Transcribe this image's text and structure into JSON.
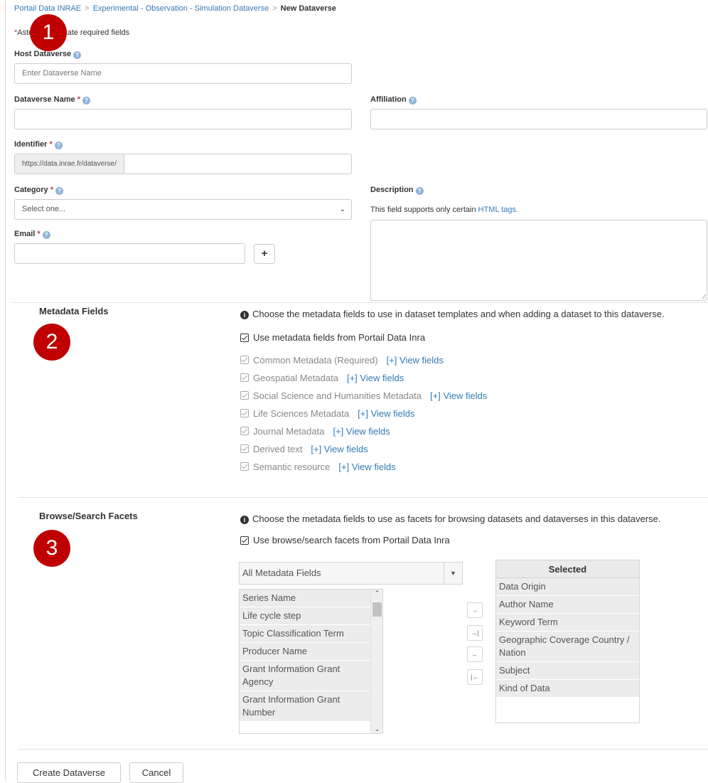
{
  "breadcrumb": {
    "items": [
      "Portail Data INRAE",
      "Experimental - Observation - Simulation Dataverse"
    ],
    "current": "New Dataverse",
    "separator": ">"
  },
  "required_note": {
    "asterisk": "*",
    "text": "Asterisks indicate required fields"
  },
  "form": {
    "host": {
      "label": "Host Dataverse",
      "placeholder": "Enter Dataverse Name"
    },
    "name": {
      "label": "Dataverse Name",
      "value": ""
    },
    "affiliation": {
      "label": "Affiliation",
      "value": ""
    },
    "identifier": {
      "label": "Identifier",
      "prefix": "https://data.inrae.fr/dataverse/",
      "value": ""
    },
    "category": {
      "label": "Category",
      "selected": "Select one..."
    },
    "description": {
      "label": "Description",
      "note": "This field supports only certain",
      "note_link": "HTML tags."
    },
    "email": {
      "label": "Email",
      "value": "",
      "add_label": "+"
    },
    "required_mark": "*",
    "help_glyph": "?"
  },
  "badges": [
    "1",
    "2",
    "3"
  ],
  "metadata_fields": {
    "title": "Metadata Fields",
    "info": "Choose the metadata fields to use in dataset templates and when adding a dataset to this dataverse.",
    "use_label": "Use metadata fields from Portail Data Inra",
    "blocks": [
      {
        "name": "Common Metadata (Required)",
        "link": "[+] View fields"
      },
      {
        "name": "Geospatial Metadata",
        "link": "[+] View fields"
      },
      {
        "name": "Social Science and Humanities Metadata",
        "link": "[+] View fields"
      },
      {
        "name": "Life Sciences Metadata",
        "link": "[+] View fields"
      },
      {
        "name": "Journal Metadata",
        "link": "[+] View fields"
      },
      {
        "name": "Derived text",
        "link": "[+] View fields"
      },
      {
        "name": "Semantic resource",
        "link": "[+] View fields"
      }
    ]
  },
  "facets": {
    "title": "Browse/Search Facets",
    "info": "Choose the metadata fields to use as facets for browsing datasets and dataverses in this dataverse.",
    "use_label": "Use browse/search facets from Portail Data Inra",
    "field_select": "All Metadata Fields",
    "source": [
      "Series Name",
      "Life cycle step",
      "Topic Classification Term",
      "Producer Name",
      "Grant Information Grant Agency",
      "Grant Information Grant Number"
    ],
    "selected_header": "Selected",
    "selected": [
      "Data Origin",
      "Author Name",
      "Keyword Term",
      "Geographic Coverage Country / Nation",
      "Subject",
      "Kind of Data"
    ],
    "move_buttons": {
      "add": "→",
      "add_all": "→|",
      "remove": "←",
      "remove_all": "|←"
    }
  },
  "actions": {
    "create": "Create Dataverse",
    "cancel": "Cancel"
  }
}
